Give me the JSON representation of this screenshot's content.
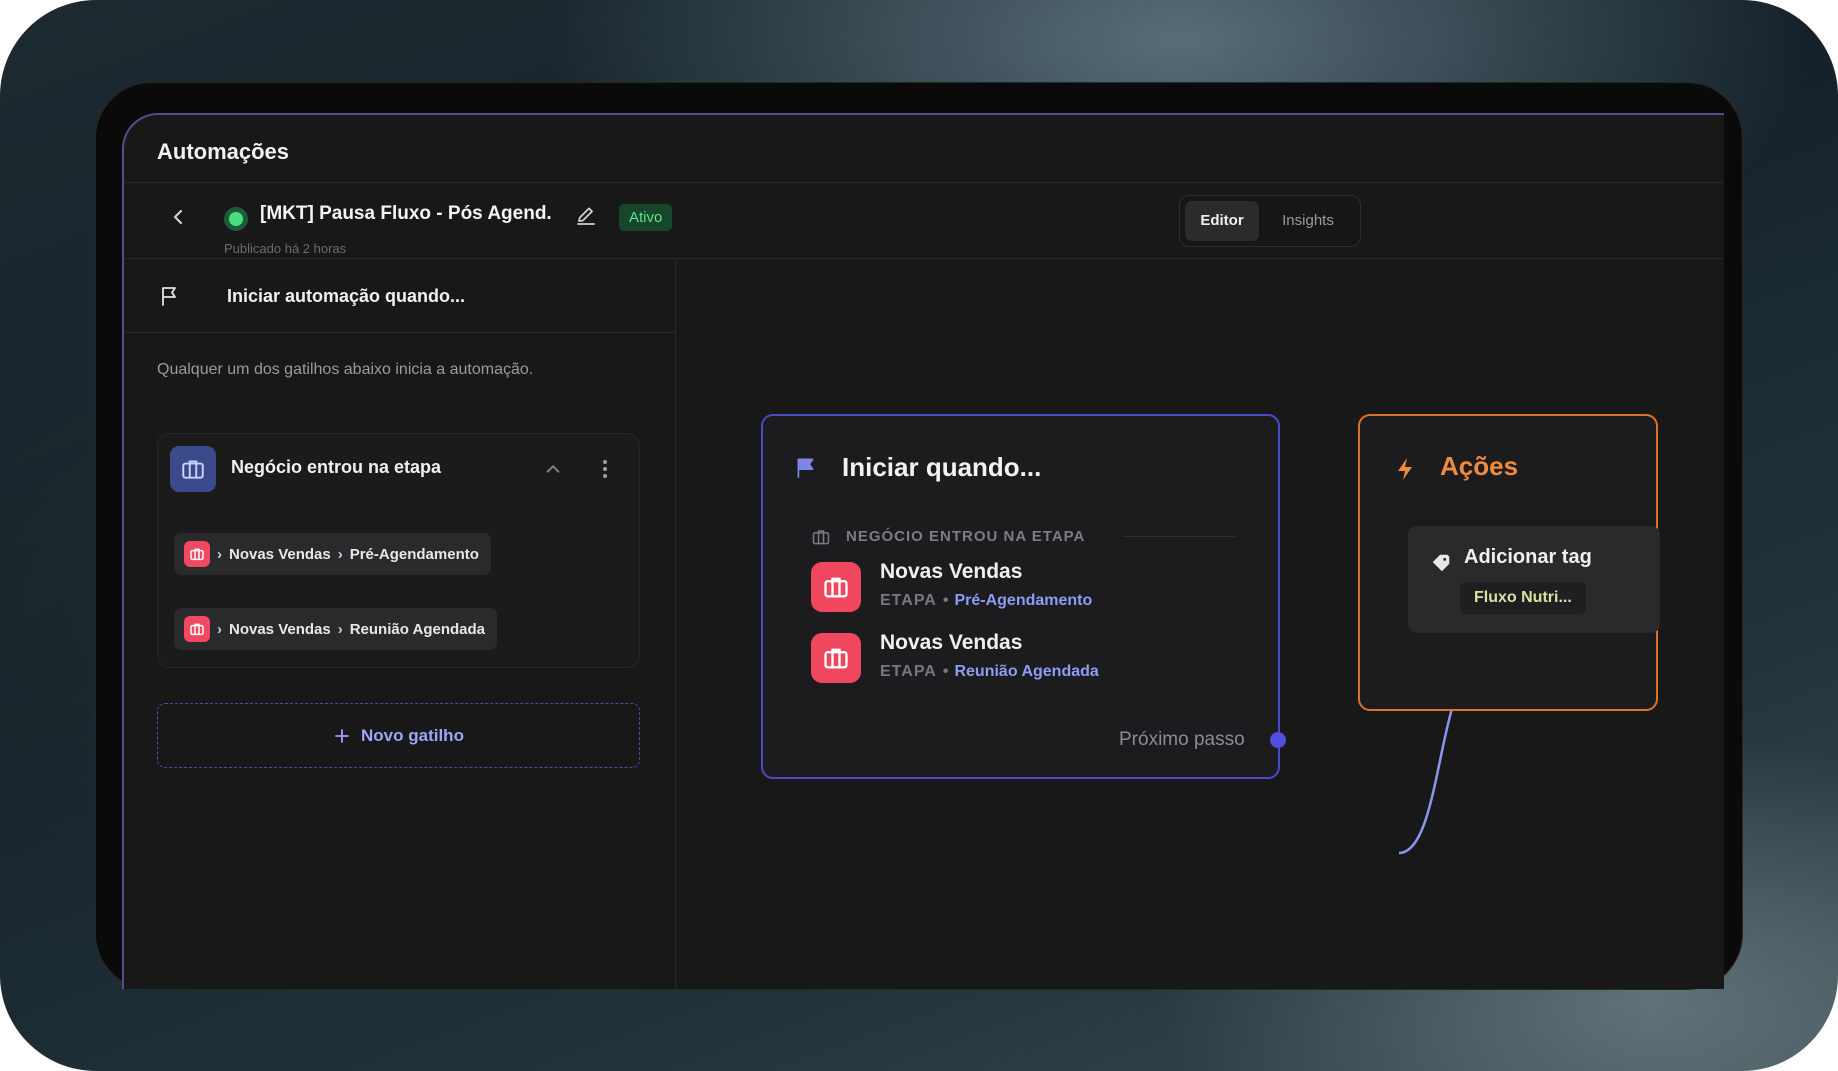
{
  "app": {
    "title": "Automações"
  },
  "flow": {
    "name": "[MKT] Pausa Fluxo - Pós Agend.",
    "status": "Ativo",
    "published": "Publicado há 2 horas",
    "status_color": "#4ade80"
  },
  "view_tabs": [
    {
      "label": "Editor",
      "active": true
    },
    {
      "label": "Insights",
      "active": false
    }
  ],
  "sidebar": {
    "header": "Iniciar automação quando...",
    "description": "Qualquer um dos gatilhos abaixo inicia a automação.",
    "trigger": {
      "title": "Negócio entrou na etapa",
      "chips": [
        {
          "pipeline": "Novas Vendas",
          "stage": "Pré-Agendamento"
        },
        {
          "pipeline": "Novas Vendas",
          "stage": "Reunião Agendada"
        }
      ]
    },
    "new_trigger_label": "Novo gatilho"
  },
  "canvas": {
    "start_node": {
      "title": "Iniciar quando...",
      "subtitle": "NEGÓCIO ENTROU NA ETAPA",
      "items": [
        {
          "title": "Novas Vendas",
          "meta_label": "ETAPA",
          "meta_value": "Pré-Agendamento"
        },
        {
          "title": "Novas Vendas",
          "meta_label": "ETAPA",
          "meta_value": "Reunião Agendada"
        }
      ],
      "next_step_label": "Próximo passo"
    },
    "actions_node": {
      "title": "Ações",
      "action": {
        "title": "Adicionar tag",
        "tag": "Fluxo Nutri..."
      }
    }
  },
  "colors": {
    "trigger_accent": "#4b4ac6",
    "actions_accent": "#d9742a",
    "stage_icon": "#f0475f",
    "link": "#8f9bf6"
  },
  "icons": {
    "back": "chevron-left-icon",
    "edit": "pencil-icon",
    "flag": "flag-icon",
    "briefcase": "briefcase-icon",
    "more": "kebab-icon",
    "collapse": "chevron-up-icon",
    "add": "plus-icon",
    "bolt": "bolt-icon",
    "tag": "tag-icon"
  }
}
